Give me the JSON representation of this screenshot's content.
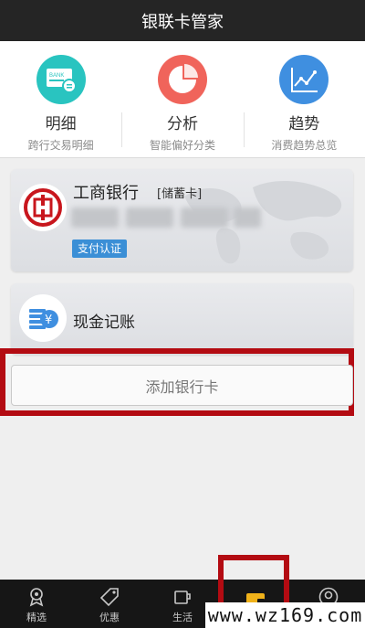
{
  "header": {
    "title": "银联卡管家"
  },
  "features": [
    {
      "title": "明细",
      "subtitle": "跨行交易明细",
      "icon": "bank-card-icon",
      "color": "#29c4c0"
    },
    {
      "title": "分析",
      "subtitle": "智能偏好分类",
      "icon": "pie-chart-icon",
      "color": "#f0645b"
    },
    {
      "title": "趋势",
      "subtitle": "消费趋势总览",
      "icon": "trend-chart-icon",
      "color": "#3f8fe0"
    }
  ],
  "bank_card": {
    "bank_name": "工商银行",
    "card_type": "[储蓄卡]",
    "badge": "支付认证",
    "logo": "icbc-logo-icon",
    "logo_color": "#c8161d"
  },
  "cash_card": {
    "label": "现金记账",
    "icon": "cash-yen-icon",
    "color": "#3f8fe0"
  },
  "add_button": {
    "label": "添加银行卡"
  },
  "tabs": [
    {
      "label": "精选",
      "icon": "ribbon-icon"
    },
    {
      "label": "优惠",
      "icon": "tag-icon"
    },
    {
      "label": "生活",
      "icon": "cup-icon"
    },
    {
      "label": "",
      "icon": "wallet-icon",
      "active": true
    },
    {
      "label": "",
      "icon": "user-icon"
    }
  ],
  "watermark": "www.wz169.com",
  "accent_colors": {
    "highlight_border": "#b30b12",
    "badge": "#3b8fd6",
    "wallet_active": "#f0b21a"
  }
}
